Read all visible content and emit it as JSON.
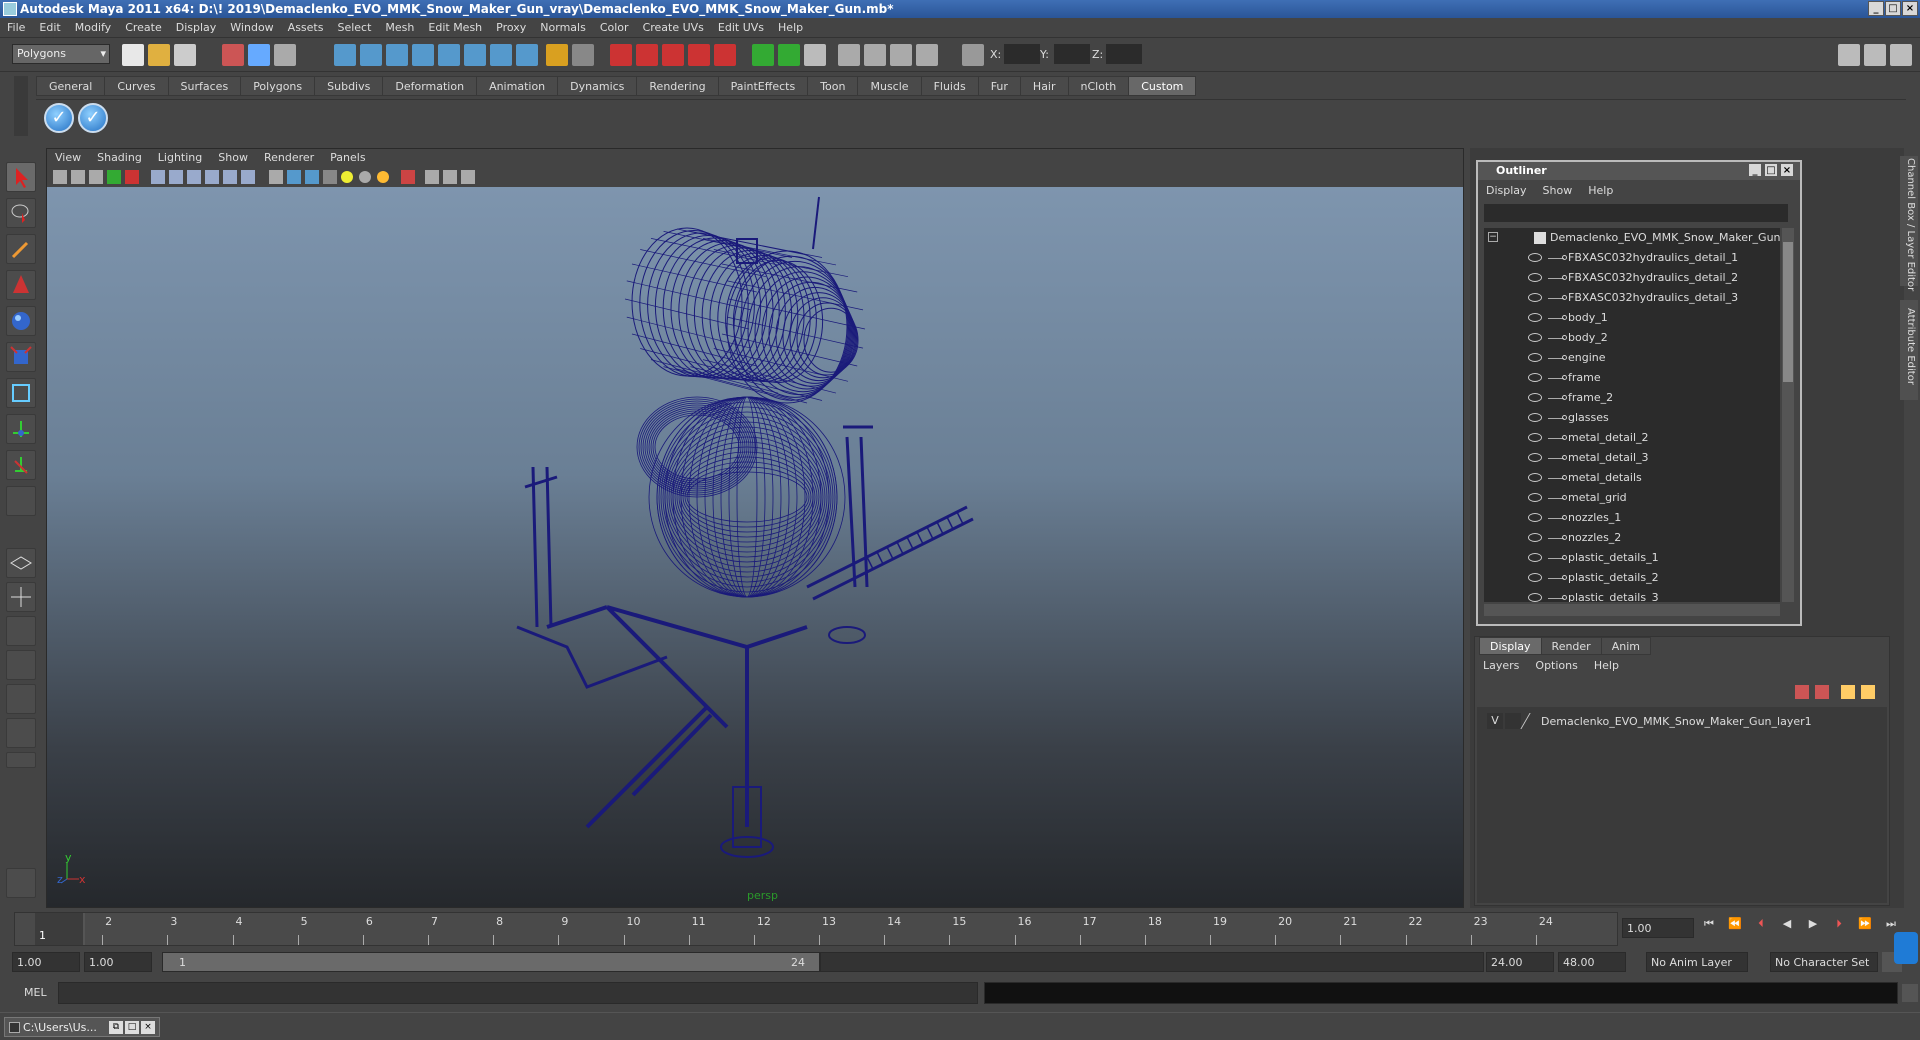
{
  "title": "Autodesk Maya 2011 x64: D:\\! 2019\\Demaclenko_EVO_MMK_Snow_Maker_Gun_vray\\Demaclenko_EVO_MMK_Snow_Maker_Gun.mb*",
  "menubar": [
    "File",
    "Edit",
    "Modify",
    "Create",
    "Display",
    "Window",
    "Assets",
    "Select",
    "Mesh",
    "Edit Mesh",
    "Proxy",
    "Normals",
    "Color",
    "Create UVs",
    "Edit UVs",
    "Help"
  ],
  "statusline": {
    "mode": "Polygons",
    "x_label": "X:",
    "y_label": "Y:",
    "z_label": "Z:"
  },
  "shelf": {
    "tabs": [
      "General",
      "Curves",
      "Surfaces",
      "Polygons",
      "Subdivs",
      "Deformation",
      "Animation",
      "Dynamics",
      "Rendering",
      "PaintEffects",
      "Toon",
      "Muscle",
      "Fluids",
      "Fur",
      "Hair",
      "nCloth",
      "Custom"
    ],
    "active": "Custom"
  },
  "viewport": {
    "menu": [
      "View",
      "Shading",
      "Lighting",
      "Show",
      "Renderer",
      "Panels"
    ],
    "camera": "persp",
    "axis_x": "x",
    "axis_y": "y",
    "axis_z": "z",
    "wire_color": "#1a1a7a"
  },
  "side_tabs": {
    "channel_box": "Channel Box / Layer Editor",
    "attribute_editor": "Attribute Editor"
  },
  "outliner": {
    "title": "Outliner",
    "menu": [
      "Display",
      "Show",
      "Help"
    ],
    "root": "Demaclenko_EVO_MMK_Snow_Maker_Gun",
    "items": [
      "FBXASC032hydraulics_detail_1",
      "FBXASC032hydraulics_detail_2",
      "FBXASC032hydraulics_detail_3",
      "body_1",
      "body_2",
      "engine",
      "frame",
      "frame_2",
      "glasses",
      "metal_detail_2",
      "metal_detail_3",
      "metal_details",
      "metal_grid",
      "nozzles_1",
      "nozzles_2",
      "plastic_details_1",
      "plastic_details_2",
      "plastic_details_3"
    ]
  },
  "layers": {
    "tabs": [
      "Display",
      "Render",
      "Anim"
    ],
    "active": "Display",
    "menu": [
      "Layers",
      "Options",
      "Help"
    ],
    "layer_visible": "V",
    "layer_name": "Demaclenko_EVO_MMK_Snow_Maker_Gun_layer1"
  },
  "timeline": {
    "ticks": [
      "1",
      "2",
      "3",
      "4",
      "5",
      "6",
      "7",
      "8",
      "9",
      "10",
      "11",
      "12",
      "13",
      "14",
      "15",
      "16",
      "17",
      "18",
      "19",
      "20",
      "21",
      "22",
      "23",
      "24"
    ],
    "current_marker": "1",
    "current_frame": "1.00"
  },
  "range": {
    "start": "1.00",
    "inner_start": "1.00",
    "slider_start": "1",
    "slider_end": "24",
    "end": "24.00",
    "outer_end": "48.00",
    "anim_layer": "No Anim Layer",
    "char_set": "No Character Set"
  },
  "mel": {
    "label": "MEL"
  },
  "taskbar": {
    "item": "C:\\Users\\Us..."
  }
}
